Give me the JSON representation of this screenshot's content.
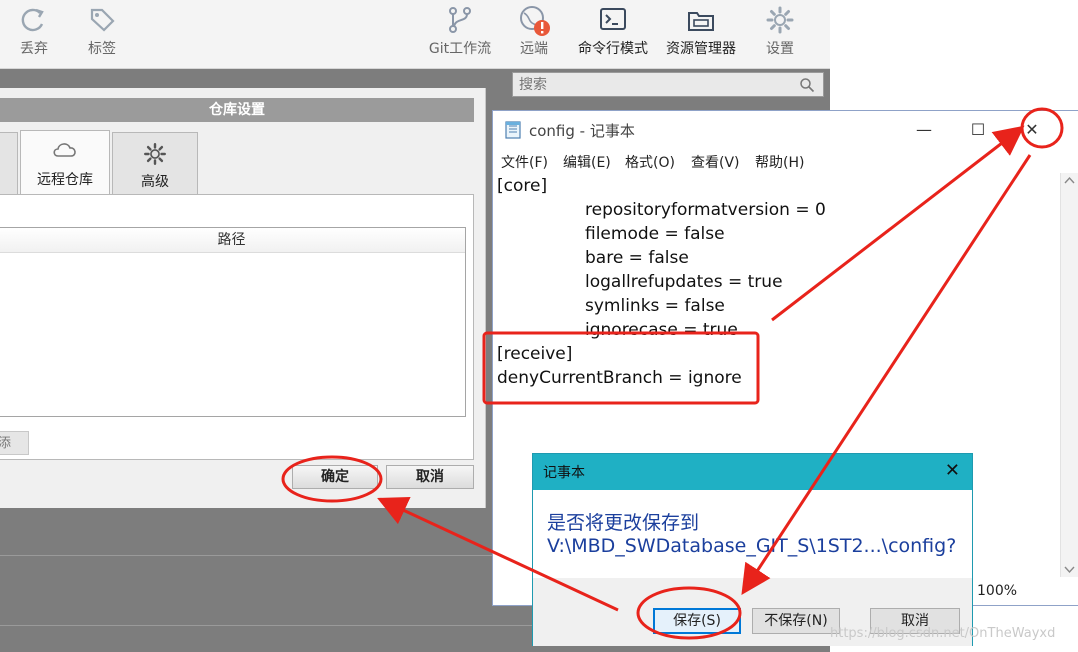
{
  "toolbar": {
    "discard": "丢弃",
    "tag": "标签",
    "git_flow": "Git工作流",
    "remote": "远端",
    "terminal": "命令行模式",
    "explorer": "资源管理器",
    "settings": "设置",
    "search_placeholder": "搜索"
  },
  "repo_dialog": {
    "title": "仓库设置",
    "tabs": [
      {
        "label": "远程仓库",
        "icon": "cloud-icon"
      },
      {
        "label": "高级",
        "icon": "gear-icon"
      }
    ],
    "table_header": "路径",
    "stub_button": "添",
    "ok": "确定",
    "cancel": "取消"
  },
  "notepad": {
    "title": "config - 记事本",
    "menu": [
      "文件(F)",
      "编辑(E)",
      "格式(O)",
      "查看(V)",
      "帮助(H)"
    ],
    "lines": [
      "[core]",
      "repositoryformatversion = 0",
      "filemode = false",
      "bare = false",
      "logallrefupdates = true",
      "symlinks = false",
      "ignorecase = true",
      "[receive]",
      "denyCurrentBranch = ignore"
    ],
    "zoom": "100%"
  },
  "save_dialog": {
    "title": "记事本",
    "message_line1": "是否将更改保存到",
    "message_line2": "V:\\MBD_SWDatabase_GIT_S\\1ST2...\\config?",
    "save": "保存(S)",
    "dont_save": "不保存(N)",
    "cancel": "取消"
  },
  "watermark": "https://blog.csdn.net/OnTheWayxd",
  "colors": {
    "annotation_red": "#e8231b",
    "dialog_title_bar": "#1fb0c4",
    "message_blue": "#1b3f9d",
    "primary_button_border": "#0078d7"
  }
}
